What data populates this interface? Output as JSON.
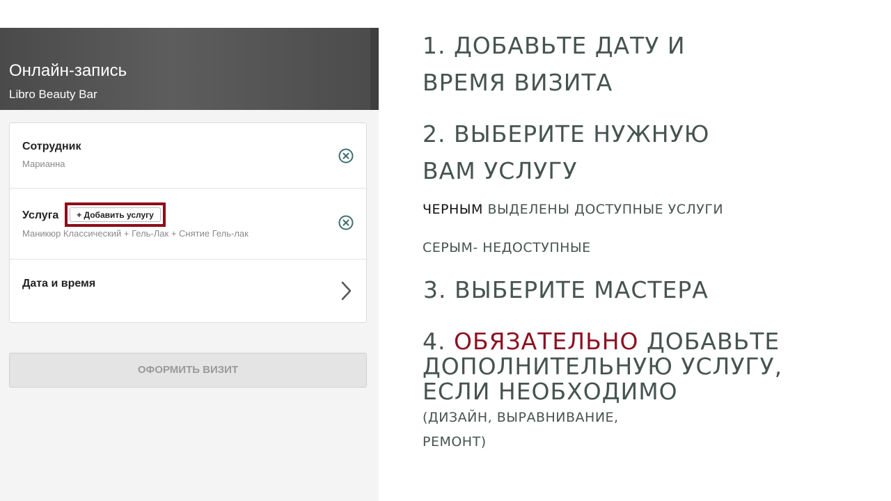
{
  "app": {
    "title": "Онлайн-запись",
    "subtitle": "Libro Beauty Bar",
    "rows": {
      "employee": {
        "title": "Сотрудник",
        "value": "Марианна"
      },
      "service": {
        "title": "Услуга",
        "value": "Маникюр Классический + Гель-Лак + Снятие Гель-лак",
        "add_label": "+ Добавить услугу"
      },
      "datetime": {
        "title": "Дата и время"
      }
    },
    "submit_label": "ОФОРМИТЬ ВИЗИТ",
    "icons": {
      "clear": "close-circle-icon",
      "chevron": "chevron-right-icon"
    }
  },
  "instructions": {
    "step1_line1": "1. ДОБАВЬТЕ ДАТУ И",
    "step1_line2": "ВРЕМЯ ВИЗИТА",
    "step2_line1": "2. ВЫБЕРИТЕ НУЖНУЮ",
    "step2_line2": "ВАМ УСЛУГУ",
    "note1_black": "ЧЕРНЫМ",
    "note1_rest": " ВЫДЕЛЕНЫ ДОСТУПНЫЕ УСЛУГИ",
    "note2": "СЕРЫМ- НЕДОСТУПНЫЕ",
    "step3": "3. ВЫБЕРИТЕ МАСТЕРА",
    "step4_prefix": "4. ",
    "step4_accent": "ОБЯЗАТЕЛЬНО",
    "step4_rest": " ДОБАВЬТЕ",
    "step4_line2": "ДОПОЛНИТЕЛЬНУЮ УСЛУГУ,",
    "step4_line3": "ЕСЛИ НЕОБХОДИМО",
    "step4_note1": "(ДИЗАЙН, ВЫРАВНИВАНИЕ,",
    "step4_note2": "РЕМОНТ)"
  },
  "colors": {
    "accent": "#8b1221",
    "instruction_text": "#465451",
    "highlight_border": "#8d0c1a"
  }
}
